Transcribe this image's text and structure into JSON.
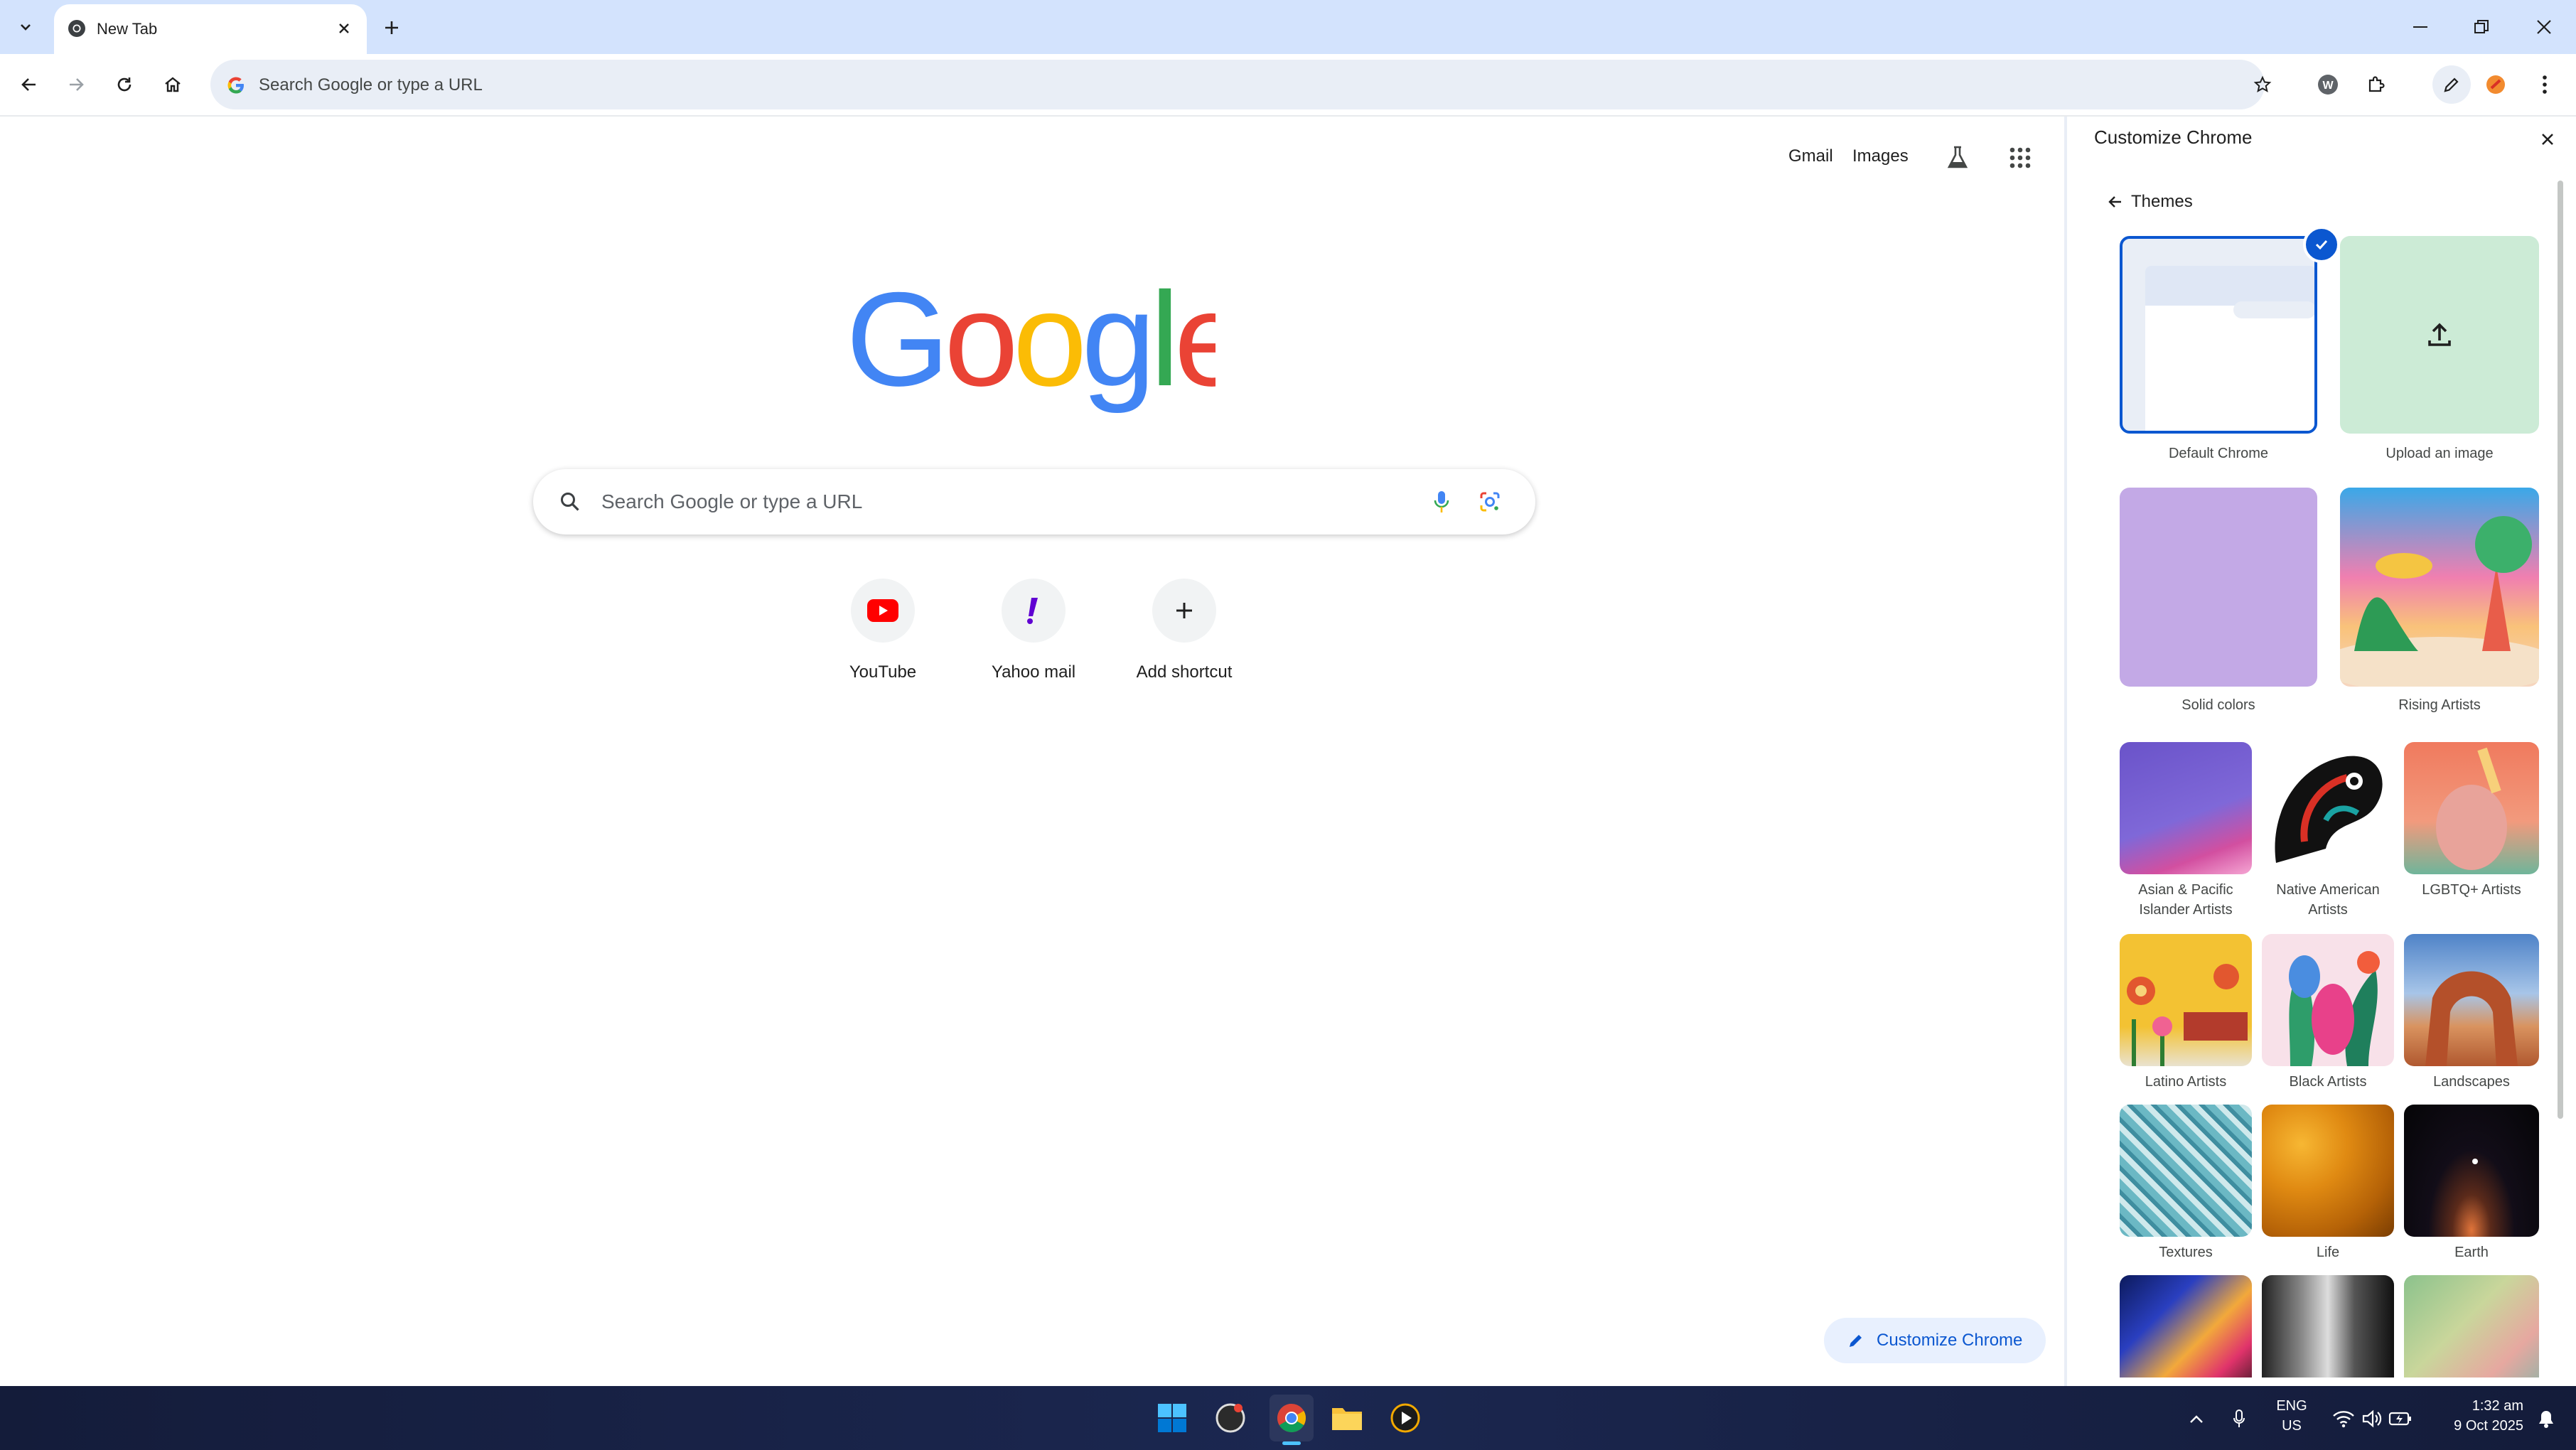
{
  "tabstrip": {
    "tab_title": "New Tab"
  },
  "toolbar": {
    "omnibox_placeholder": "Search Google or type a URL"
  },
  "ntp": {
    "links": {
      "gmail": "Gmail",
      "images": "Images"
    },
    "logo_text": "Google",
    "search_placeholder": "Search Google or type a URL",
    "shortcuts": [
      {
        "label": "YouTube",
        "icon": "youtube-icon"
      },
      {
        "label": "Yahoo mail",
        "icon": "yahoo-icon"
      },
      {
        "label": "Add shortcut",
        "icon": "plus-icon"
      }
    ],
    "customize_label": "Customize Chrome"
  },
  "panel": {
    "title": "Customize Chrome",
    "back_label": "Themes",
    "themes_large": [
      {
        "label": "Default Chrome",
        "selected": true
      },
      {
        "label": "Upload an image"
      },
      {
        "label": "Solid colors"
      },
      {
        "label": "Rising Artists"
      }
    ],
    "themes_small": [
      {
        "label": "Asian & Pacific Islander Artists",
        "line1": "Asian & Pacific",
        "line2": "Islander Artists"
      },
      {
        "label": "Native American Artists",
        "line1": "Native American",
        "line2": "Artists"
      },
      {
        "label": "LGBTQ+ Artists"
      },
      {
        "label": "Latino Artists"
      },
      {
        "label": "Black Artists"
      },
      {
        "label": "Landscapes"
      },
      {
        "label": "Textures"
      },
      {
        "label": "Life"
      },
      {
        "label": "Earth"
      }
    ]
  },
  "taskbar": {
    "lang1": "ENG",
    "lang2": "US",
    "time": "1:32 am",
    "date": "9 Oct 2025"
  },
  "colors": {
    "accent": "#0b57d0",
    "tabstrip": "#d3e3fd",
    "omnibox": "#e9eef6",
    "google_blue": "#4285f4",
    "google_red": "#ea4335",
    "google_yellow": "#fbbc05",
    "google_green": "#34a853"
  }
}
